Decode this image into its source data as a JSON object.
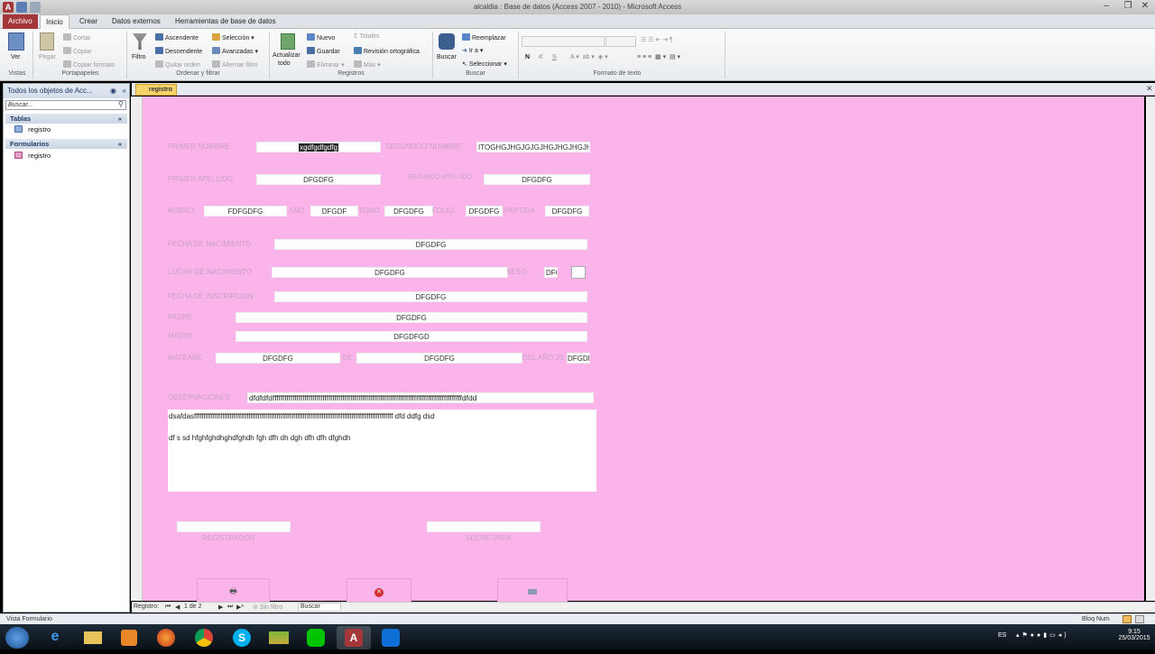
{
  "window": {
    "title": "alcaldia : Base de datos (Access 2007 - 2010) - Microsoft Access"
  },
  "ribbon": {
    "tabs": [
      "Archivo",
      "Inicio",
      "Crear",
      "Datos externos",
      "Herramientas de base de datos"
    ],
    "vistas": {
      "ver": "Ver",
      "label": "Vistas"
    },
    "portapapeles": {
      "pegar": "Pegar",
      "cortar": "Cortar",
      "copiar": "Copiar",
      "copiar_formato": "Copiar formato",
      "label": "Portapapeles"
    },
    "ordenar": {
      "filtro": "Filtro",
      "ascendente": "Ascendente",
      "descendente": "Descendente",
      "quitar_orden": "Quitar orden",
      "seleccion": "Selección",
      "avanzadas": "Avanzadas",
      "alternar_filtro": "Alternar filtro",
      "label": "Ordenar y filtrar"
    },
    "registros": {
      "actualizar": "Actualizar",
      "todo": "todo",
      "nuevo": "Nuevo",
      "guardar": "Guardar",
      "eliminar": "Eliminar",
      "totales": "Totales",
      "revision": "Revisión ortográfica",
      "mas": "Más",
      "label": "Registros"
    },
    "buscar": {
      "buscar": "Buscar",
      "reemplazar": "Reemplazar",
      "ir_a": "Ir a",
      "seleccionar": "Seleccionar",
      "label": "Buscar"
    },
    "formato": {
      "label": "Formato de texto",
      "bold": "N",
      "italic": "K",
      "underline": "S"
    }
  },
  "nav": {
    "header": "Todos los objetos de Acc...",
    "search_placeholder": "Buscar...",
    "groups": [
      {
        "name": "Tablas",
        "items": [
          "registro"
        ]
      },
      {
        "name": "Formularios",
        "items": [
          "registro"
        ]
      }
    ]
  },
  "doc_tab": "registro",
  "form": {
    "primer_nombre_label": "PRIMER NOMBRE",
    "primer_nombre": "xgdfgdfgdfg",
    "segundo_nombre_label": "SEGUNDOO NOMBRE",
    "segundo_nombre": "ITOGHGJHGJGJGJHGJHGJHGJHG",
    "primer_apellido_label": "PRIMER APELLIDO",
    "primer_apellido": "DFGDFG",
    "segundo_apellido_label": "SEGUNDO APELLIDO",
    "segundo_apellido": "DFGDFG",
    "rubro_label": "RUBRO",
    "rubro": "FDFGDFG",
    "anio_label": "AÑO",
    "anio": "DFGDF",
    "tomo_label": "TOMO",
    "tomo": "DFGDFG",
    "folio_label": "FOLIO",
    "folio": "DFGDFG",
    "partida_label": "PARTIDA",
    "partida": "DFGDFG",
    "fecha_nac_label": "FECHA DE NACIMIENTO",
    "fecha_nac": "DFGDFG",
    "lugar_nac_label": "LUGAR DE NACIMIENTO",
    "lugar_nac": "DFGDFG",
    "sexo_label": "SEXO",
    "sexo": "DFG",
    "fecha_insc_label": "FECHA DE INSCRIPCION",
    "fecha_insc": "DFGDFG",
    "padre_label": "PADRE",
    "padre": "DFGDFG",
    "madre_label": "MADRE",
    "madre": "DFGDFGD",
    "mateare_label": "MATEARE",
    "mateare": "DFGDFG",
    "de_label": "DE",
    "de": "DFGDFG",
    "del_anio_label": "DEL AÑO 20",
    "del_anio": "DFGDF",
    "observaciones_label": "OBSERVACIONES",
    "observaciones_line": "dfdfdfdfffffffffffffffffffffffffffffffffffffffffffffffffffffffffffffffffffffffffffffffffffffffffffffffdfdd",
    "memo_line1": "dsafdasffffffffffffffffffffffffffffffffffffffffffffffffffffffffffffffffffffffffffffffffffffffffffffffffffffffffff dfd ddfg dsd",
    "memo_line2": "df s sd hfghfghdhghdfghdh fgh dfh dh dgh dfh dfh dfghdh",
    "registrador_label": "REGISTRADOR",
    "secretaria_label": "SECRETARIA"
  },
  "record_nav": {
    "label": "Registro:",
    "position": "1 de 2",
    "filter": "Sin filtro",
    "search": "Buscar"
  },
  "status": {
    "left": "Vista Formulario",
    "right": "Bloq Num"
  },
  "tray": {
    "lang": "ES",
    "time": "9:15",
    "date": "25/03/2015"
  }
}
